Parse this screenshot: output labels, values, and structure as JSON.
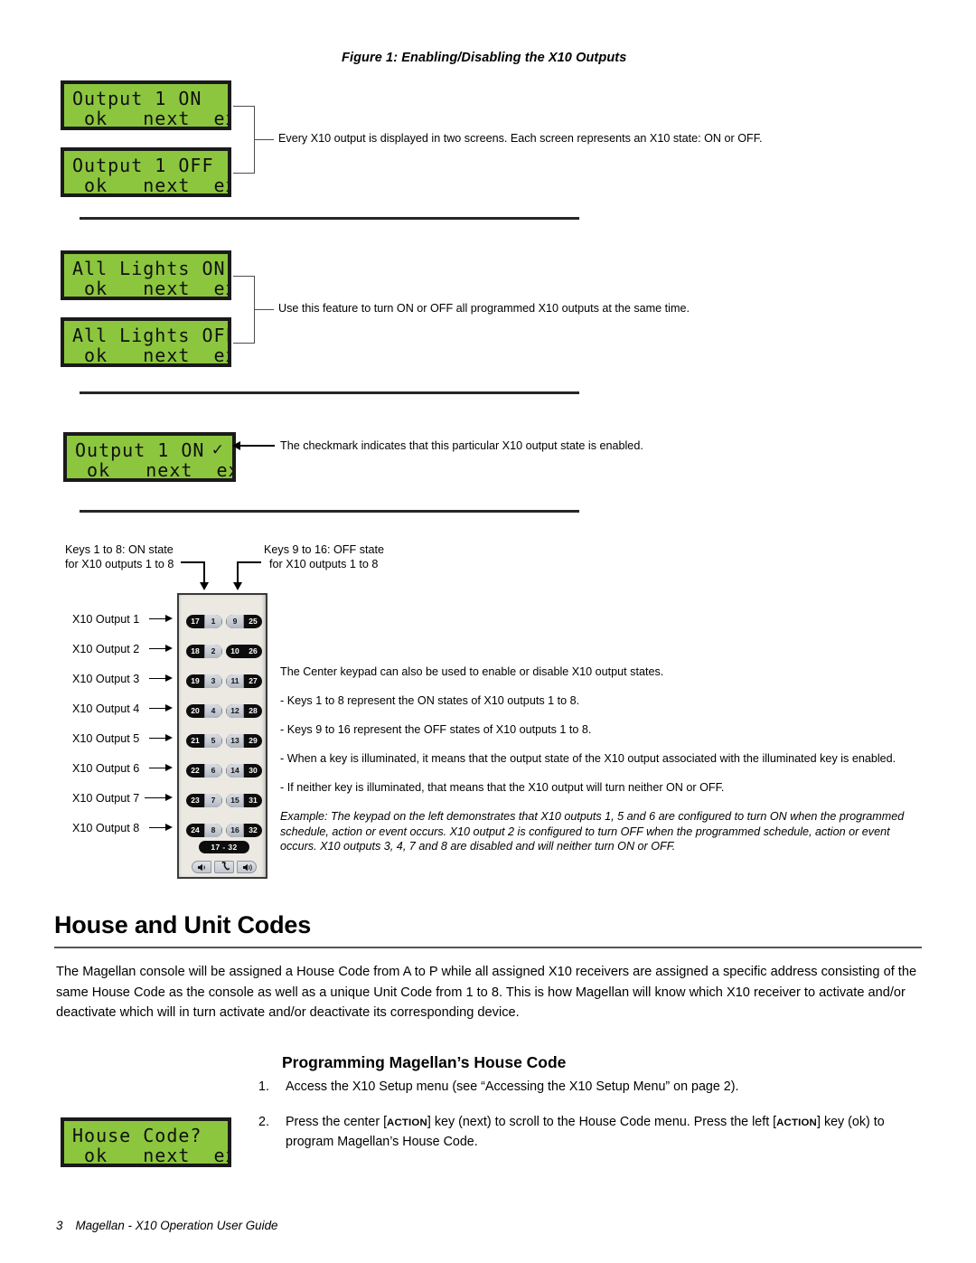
{
  "figure": {
    "caption": "Figure 1:  Enabling/Disabling the X10 Outputs"
  },
  "lcd_screens": [
    {
      "id": "output-1-on",
      "line1": "Output 1 ON",
      "line2": " ok   next  exit",
      "check": ""
    },
    {
      "id": "output-1-off",
      "line1": "Output 1 OFF",
      "line2": " ok   next  exit",
      "check": ""
    },
    {
      "id": "all-lights-on",
      "line1": "All Lights ON",
      "line2": " ok   next  exit",
      "check": ""
    },
    {
      "id": "all-lights-off",
      "line1": "All Lights OFF",
      "line2": " ok   next  exit",
      "check": ""
    },
    {
      "id": "output-1-on-checked",
      "line1": "Output 1 ON",
      "line2": " ok   next  exit",
      "check": "✓"
    },
    {
      "id": "house-code",
      "line1": "House Code?",
      "line2": " ok   next  exit",
      "check": ""
    }
  ],
  "callouts": {
    "two_screens": "Every X10 output is displayed in two screens. Each screen represents an X10 state: ON or OFF.",
    "all_lights": "Use this feature to turn ON or OFF all programmed X10 outputs at the same time.",
    "checkmark": "The checkmark indicates that this particular X10 output state is enabled."
  },
  "keypad_diagram": {
    "top_label_left": {
      "line1": "Keys 1 to 8: ON state",
      "line2": "for X10 outputs 1 to 8"
    },
    "top_label_right": {
      "line1": "Keys 9 to 16: OFF state",
      "line2": "for X10 outputs 1 to 8"
    },
    "output_labels": [
      "X10 Output 1",
      "X10 Output 2",
      "X10 Output 3",
      "X10 Output 4",
      "X10 Output 5",
      "X10 Output 6",
      "X10 Output 7",
      "X10 Output 8"
    ],
    "rows": [
      {
        "left_outer": "17",
        "left_inner": "1",
        "right_inner": "9",
        "right_outer": "25"
      },
      {
        "left_outer": "18",
        "left_inner": "2",
        "right_inner": "10",
        "right_outer": "26"
      },
      {
        "left_outer": "19",
        "left_inner": "3",
        "right_inner": "11",
        "right_outer": "27"
      },
      {
        "left_outer": "20",
        "left_inner": "4",
        "right_inner": "12",
        "right_outer": "28"
      },
      {
        "left_outer": "21",
        "left_inner": "5",
        "right_inner": "13",
        "right_outer": "29"
      },
      {
        "left_outer": "22",
        "left_inner": "6",
        "right_inner": "14",
        "right_outer": "30"
      },
      {
        "left_outer": "23",
        "left_inner": "7",
        "right_inner": "15",
        "right_outer": "31"
      },
      {
        "left_outer": "24",
        "left_inner": "8",
        "right_inner": "16",
        "right_outer": "32"
      }
    ],
    "range_button": "17 - 32",
    "function_keys": [
      "speaker-low-icon",
      "phone-icon",
      "speaker-high-icon"
    ],
    "notes": {
      "intro": "The Center keypad can also be used to enable or disable X10 output states.",
      "bullets": [
        "- Keys 1 to 8 represent the ON states of X10 outputs 1 to 8.",
        "- Keys 9 to 16 represent the OFF states of X10 outputs 1 to 8.",
        "- When a key is illuminated, it means that the output state of the X10 output associated with the illuminated key is enabled.",
        "- If neither key is illuminated, that means that the X10 output will turn neither ON or OFF."
      ],
      "example": "Example: The keypad on the left demonstrates that X10 outputs 1, 5 and 6 are configured to turn ON when the programmed schedule, action or event occurs. X10 output 2 is configured to turn OFF when the programmed schedule, action or event occurs. X10 outputs 3, 4, 7 and 8 are disabled and will neither turn ON or OFF."
    }
  },
  "section": {
    "title": "House and Unit Codes",
    "paragraph": "The Magellan console will be assigned a House Code from A to P while all assigned X10 receivers are assigned a specific address consisting of the same House Code as the console as well as a unique Unit Code from 1 to 8. This is how Magellan will know which X10 receiver to activate and/or deactivate which will in turn activate and/or deactivate its corresponding device.",
    "subtitle": "Programming Magellan’s House Code",
    "steps": [
      {
        "num": "1.",
        "text": "Access the X10 Setup menu (see “Accessing the X10 Setup Menu” on page 2)."
      },
      {
        "num": "2.",
        "text_a": "Press the center [",
        "kbd_a": "ACTION",
        "text_b": "] key (next) to scroll to the House Code menu. Press the left [",
        "kbd_b": "ACTION",
        "text_c": "] key (ok) to program Magellan’s House Code."
      }
    ]
  },
  "footer": {
    "page": "3",
    "title": "Magellan - X10 Operation User Guide"
  },
  "colors": {
    "lcd_green": "#8cc63e",
    "lcd_border": "#1a1a1a",
    "keypad_body": "#ebe9e2",
    "key_dark": "#0d0d0d"
  }
}
